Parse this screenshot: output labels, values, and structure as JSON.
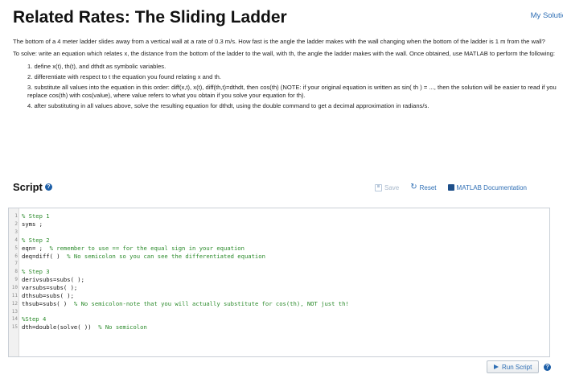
{
  "header": {
    "title": "Related Rates: The Sliding Ladder",
    "my_solutions": "My Solutio"
  },
  "problem": {
    "statement": "The bottom of a 4 meter ladder slides away from a vertical wall at a rate of 0.3 m/s. How fast is the angle the ladder makes with the wall changing when the bottom of the ladder is 1 m from the wall?",
    "instructions": "To solve: write an equation which relates x, the distance from the bottom of the ladder to the wall, with th, the angle the ladder makes with the wall. Once obtained, use MATLAB to perform the following:",
    "steps": [
      "1. define x(t), th(t), and dthdt as symbolic variables.",
      "2. differentiate with respect to t the equation you found relating x and th.",
      "3. substitute all values into the equation in this order: diff(x,t), x(t), diff(th,t)=dthdt, then cos(th) (NOTE: if your original equation is written as sin( th ) = ..., then the solution will be easier to read if you replace cos(th) with cos(value), where value refers to what you obtain if you solve your equation for th).",
      "4. after substituting in all values above, solve the resulting equation for dthdt, using the double command to get a decimal approximation in radians/s."
    ]
  },
  "script": {
    "heading": "Script",
    "help_icon": "question-circle-icon",
    "save_label": "Save",
    "reset_label": "Reset",
    "doc_label": "MATLAB Documentation"
  },
  "editor": {
    "lines": [
      {
        "num": "1",
        "code": "",
        "comment": "% Step 1"
      },
      {
        "num": "2",
        "code": "syms ;",
        "comment": ""
      },
      {
        "num": "3",
        "code": "",
        "comment": ""
      },
      {
        "num": "4",
        "code": "",
        "comment": "% Step 2"
      },
      {
        "num": "5",
        "code": "eqn= ;  ",
        "comment": "% remember to use == for the equal sign in your equation"
      },
      {
        "num": "6",
        "code": "deq=diff( )  ",
        "comment": "% No semicolon so you can see the differentiated equation"
      },
      {
        "num": "7",
        "code": "",
        "comment": ""
      },
      {
        "num": "8",
        "code": "",
        "comment": "% Step 3"
      },
      {
        "num": "9",
        "code": "derivsubs=subs( );",
        "comment": ""
      },
      {
        "num": "10",
        "code": "varsubs=subs( );",
        "comment": ""
      },
      {
        "num": "11",
        "code": "dthsub=subs( );",
        "comment": ""
      },
      {
        "num": "12",
        "code": "thsub=subs( )  ",
        "comment": "% No semicolon-note that you will actually substitute for cos(th), NOT just th!"
      },
      {
        "num": "13",
        "code": "",
        "comment": ""
      },
      {
        "num": "14",
        "code": "",
        "comment": "%Step 4"
      },
      {
        "num": "15",
        "code": "dth=double(solve( ))  ",
        "comment": "% No semicolon"
      }
    ]
  },
  "footer": {
    "run_label": "Run Script"
  }
}
